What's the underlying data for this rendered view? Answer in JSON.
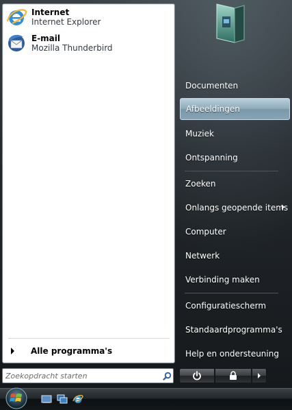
{
  "pinned": [
    {
      "title": "Internet",
      "subtitle": "Internet Explorer",
      "icon": "internet-explorer-icon"
    },
    {
      "title": "E-mail",
      "subtitle": "Mozilla Thunderbird",
      "icon": "thunderbird-icon"
    }
  ],
  "all_programs_label": "Alle programma's",
  "search": {
    "placeholder": "Zoekopdracht starten",
    "icon": "search-icon"
  },
  "right_items": [
    {
      "label": "Documenten"
    },
    {
      "label": "Afbeeldingen",
      "highlighted": true
    },
    {
      "label": "Muziek"
    },
    {
      "label": "Ontspanning"
    },
    {
      "label": "Zoeken"
    },
    {
      "label": "Onlangs geopende items",
      "has_submenu": true
    },
    {
      "label": "Computer"
    },
    {
      "label": "Netwerk"
    },
    {
      "label": "Verbinding maken"
    },
    {
      "label": "Configuratiescherm"
    },
    {
      "label": "Standaardprogramma's"
    },
    {
      "label": "Help en ondersteuning"
    }
  ],
  "power_buttons": {
    "power_icon": "power-icon",
    "lock_icon": "lock-icon",
    "more_icon": "arrow-right-icon"
  },
  "taskbar": {
    "start_icon": "windows-start-orb-icon",
    "quick_launch": [
      "show-desktop-icon",
      "switch-windows-icon",
      "internet-explorer-icon"
    ]
  },
  "colors": {
    "highlight": "#8eabbb",
    "menu_dark": "#1c2024",
    "left_pane": "#ffffff"
  }
}
